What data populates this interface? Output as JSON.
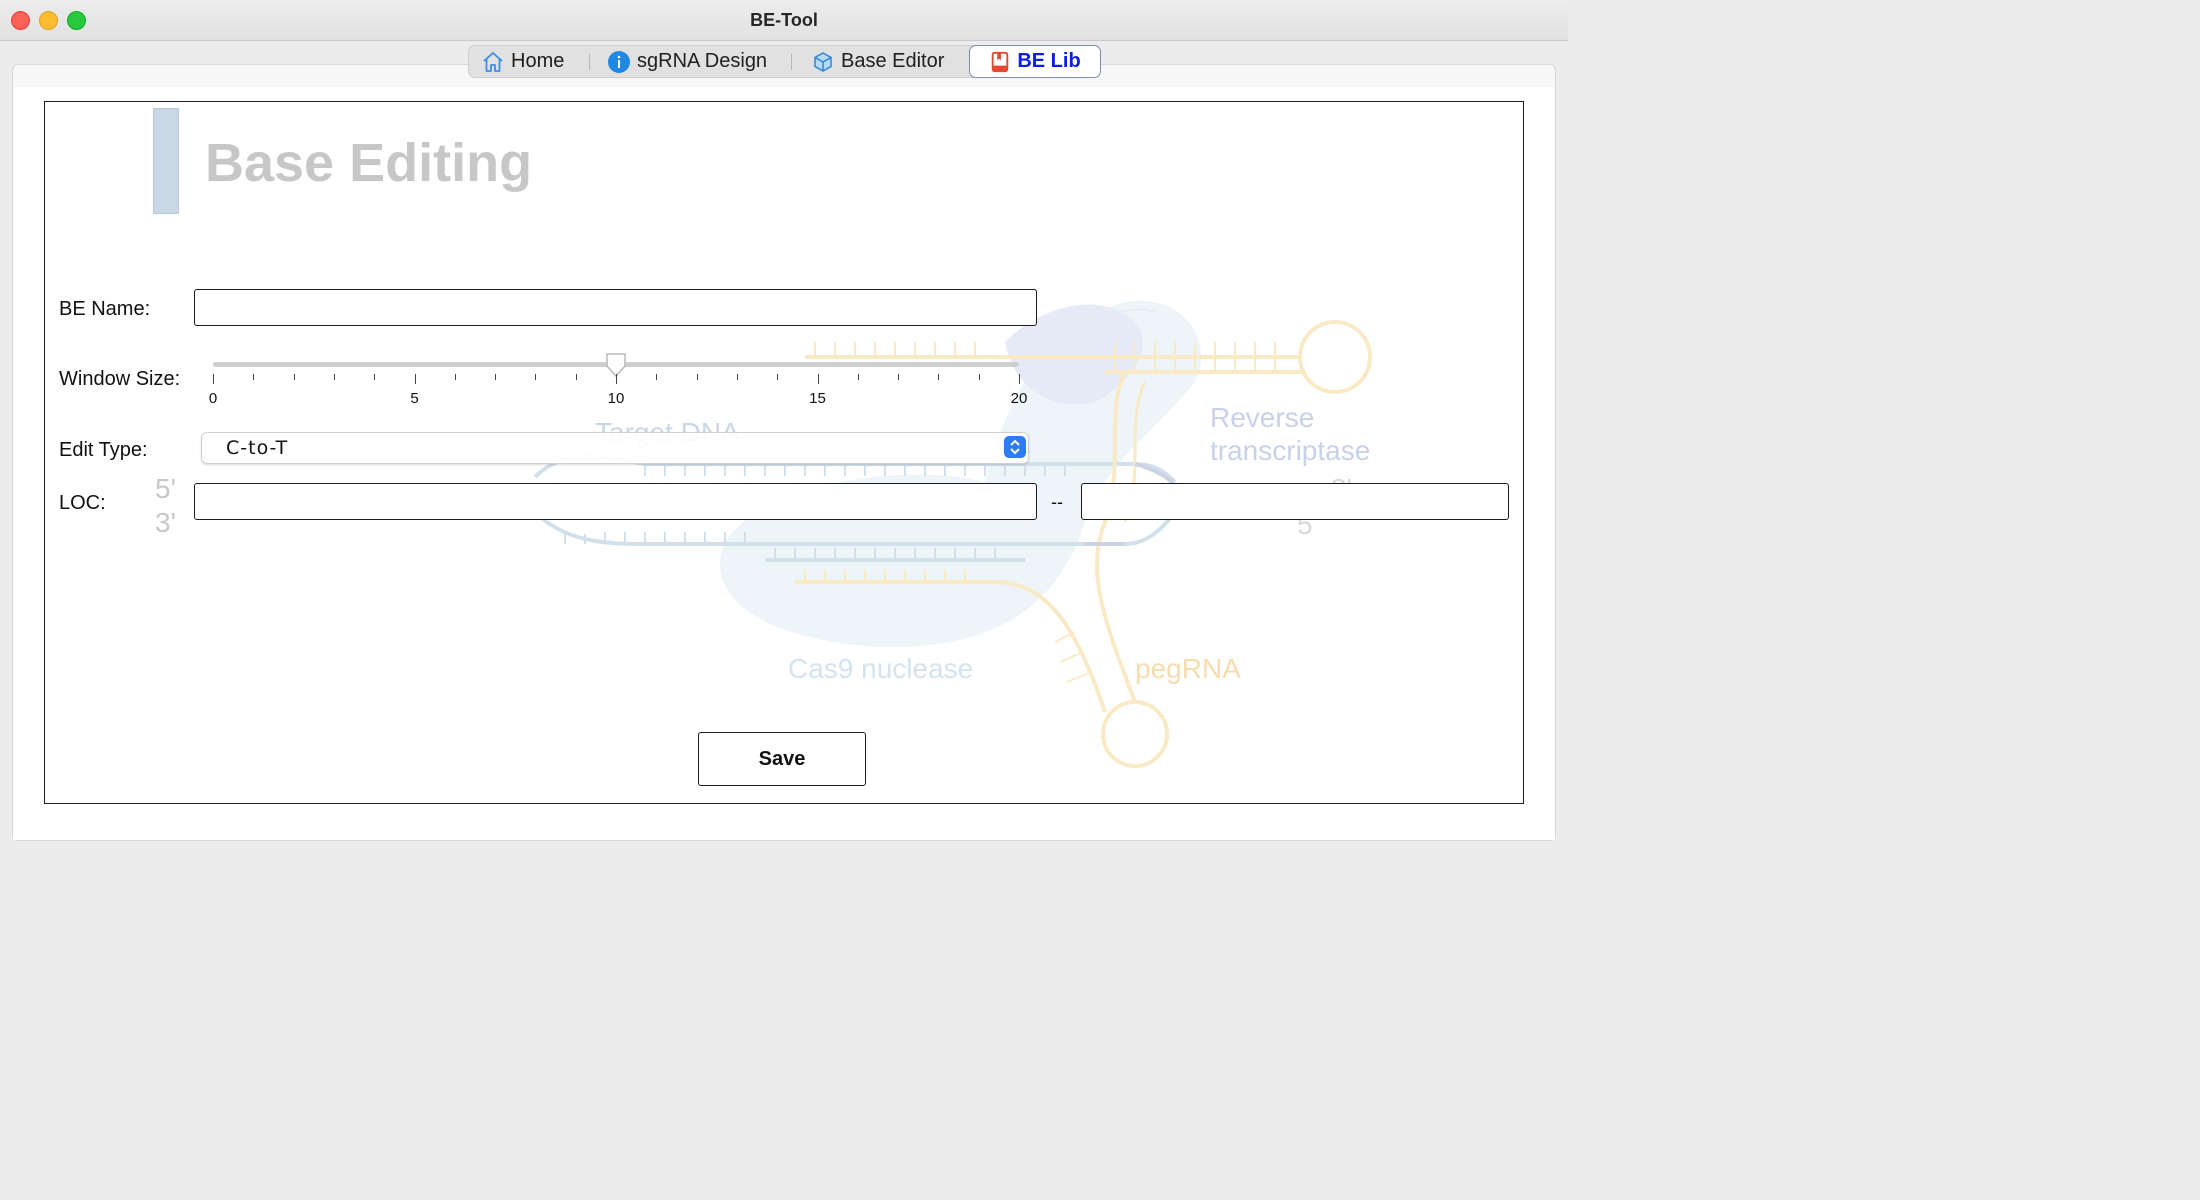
{
  "window": {
    "title": "BE-Tool"
  },
  "tabs": [
    {
      "label": "Home",
      "icon": "home-icon"
    },
    {
      "label": "sgRNA Design",
      "icon": "info-circle-icon"
    },
    {
      "label": "Base Editor",
      "icon": "cube-icon"
    },
    {
      "label": "BE Lib",
      "icon": "book-icon",
      "active": true
    }
  ],
  "heading": "Base Editing",
  "background_diagram": {
    "labels": {
      "target_dna": "Target DNA",
      "reverse_transcriptase_1": "Reverse",
      "reverse_transcriptase_2": "transcriptase",
      "cas9": "Cas9 nuclease",
      "pegrna": "pegRNA",
      "five_prime": "5'",
      "three_prime": "3'",
      "three_prime_right": "3'",
      "five_prime_right": "5"
    }
  },
  "form": {
    "be_name": {
      "label": "BE Name:",
      "value": ""
    },
    "window_size": {
      "label": "Window Size:",
      "value": 10,
      "min": 0,
      "max": 20,
      "tick_labels": [
        "0",
        "5",
        "10",
        "15",
        "20"
      ]
    },
    "edit_type": {
      "label": "Edit Type:",
      "selected": "C-to-T"
    },
    "loc": {
      "label": "LOC:",
      "start": "",
      "end": "",
      "separator": "--"
    },
    "save_label": "Save"
  },
  "colors": {
    "active_tab_text": "#0b1ee5",
    "select_arrow": "#2d7bf6",
    "traffic_close": "#fe5f57",
    "traffic_min": "#febc2e",
    "traffic_max": "#28c840"
  }
}
